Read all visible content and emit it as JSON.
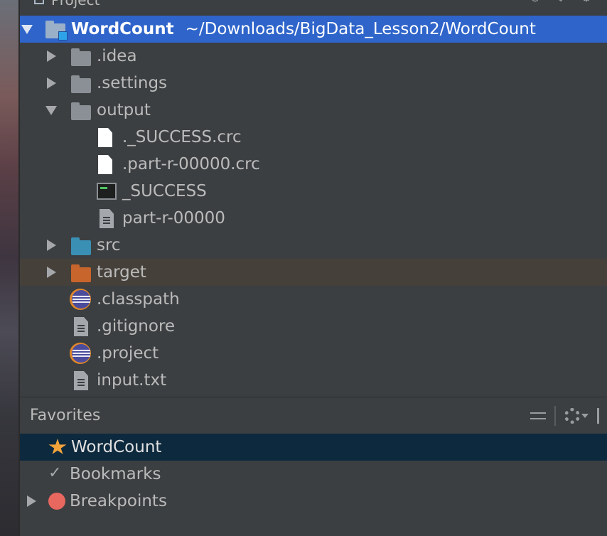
{
  "header": {
    "title": "Project"
  },
  "tree": {
    "root": {
      "name": "WordCount",
      "path": "~/Downloads/BigData_Lesson2/WordCount"
    },
    "items": [
      {
        "label": ".idea"
      },
      {
        "label": ".settings"
      },
      {
        "label": "output"
      },
      {
        "label": "._SUCCESS.crc"
      },
      {
        "label": ".part-r-00000.crc"
      },
      {
        "label": "_SUCCESS"
      },
      {
        "label": "part-r-00000"
      },
      {
        "label": "src"
      },
      {
        "label": "target"
      },
      {
        "label": ".classpath"
      },
      {
        "label": ".gitignore"
      },
      {
        "label": ".project"
      },
      {
        "label": "input.txt"
      }
    ]
  },
  "favorites": {
    "title": "Favorites",
    "items": [
      {
        "label": "WordCount"
      },
      {
        "label": "Bookmarks"
      },
      {
        "label": "Breakpoints"
      }
    ]
  },
  "colors": {
    "selection": "#2f65ca",
    "folder_source": "#3a8fb5",
    "folder_excluded": "#c7652d",
    "favorites_selection": "#0d293e"
  }
}
